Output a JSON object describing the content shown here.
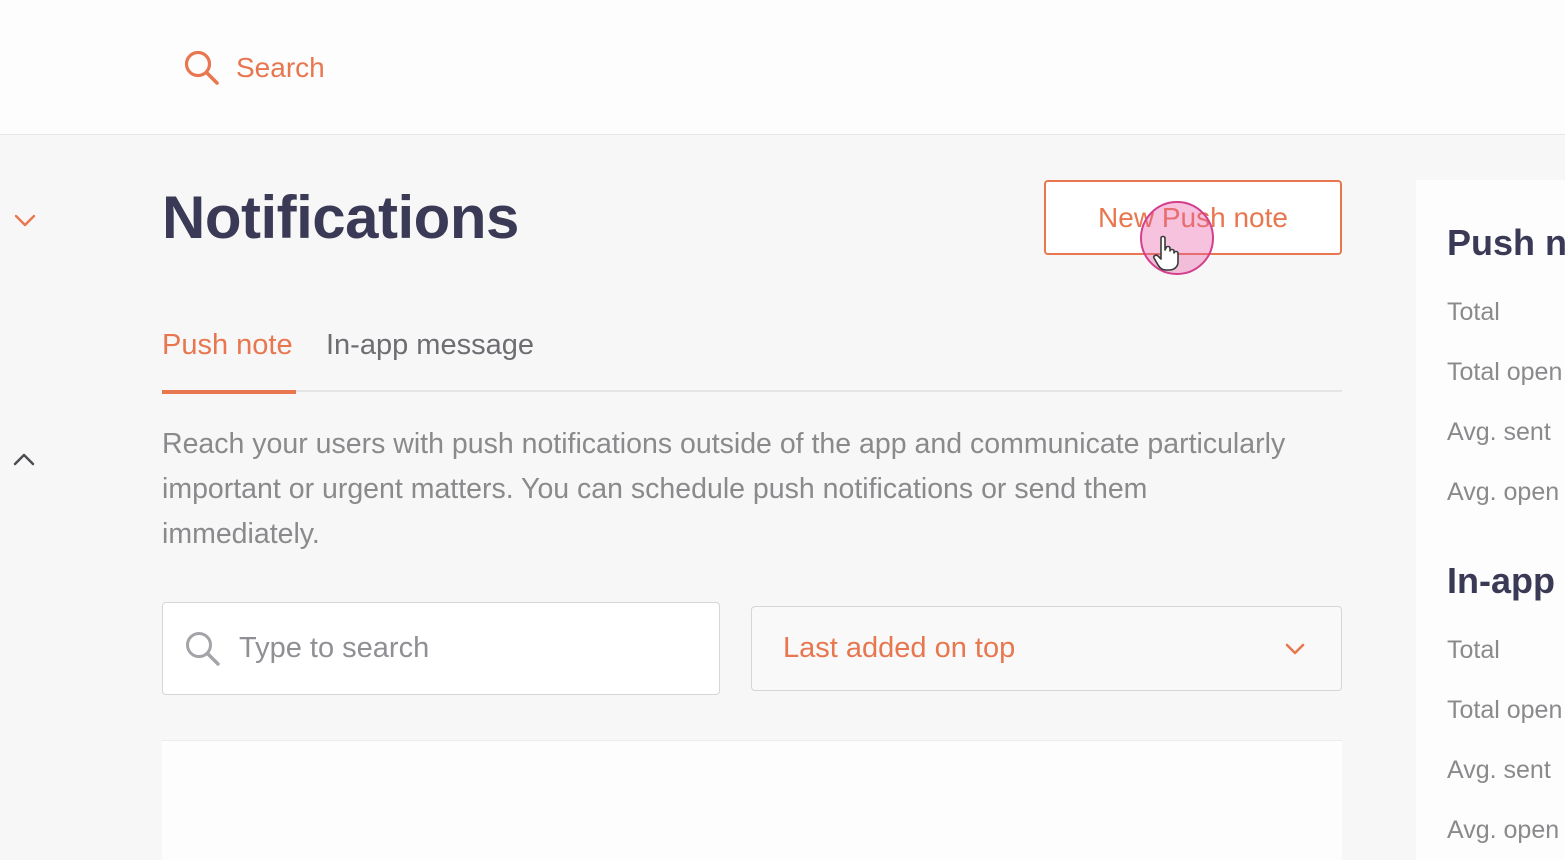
{
  "topbar": {
    "search_label": "Search"
  },
  "page": {
    "title": "Notifications",
    "new_button_label": "New Push note"
  },
  "tabs": [
    {
      "label": "Push note",
      "active": true
    },
    {
      "label": "In-app message",
      "active": false
    }
  ],
  "description": "Reach your users with push notifications outside of the app and communicate particularly important or urgent matters. You can schedule push notifications or send them immediately.",
  "search": {
    "placeholder": "Type to search",
    "value": ""
  },
  "sort": {
    "selected": "Last added on top"
  },
  "stats": {
    "push_section": {
      "title": "Push no",
      "labels": [
        "Total",
        "Total open",
        "Avg. sent",
        "Avg. open"
      ]
    },
    "inapp_section": {
      "title": "In-app m",
      "labels": [
        "Total",
        "Total open",
        "Avg. sent",
        "Avg. open"
      ]
    }
  },
  "colors": {
    "accent": "#e8774f",
    "heading": "#3b3a56",
    "muted": "#8a8a8d",
    "cursor_highlight": "#e85fa8"
  },
  "icons": [
    "search-icon",
    "chevron-down-icon",
    "chevron-up-icon",
    "pointer-hand-icon"
  ]
}
